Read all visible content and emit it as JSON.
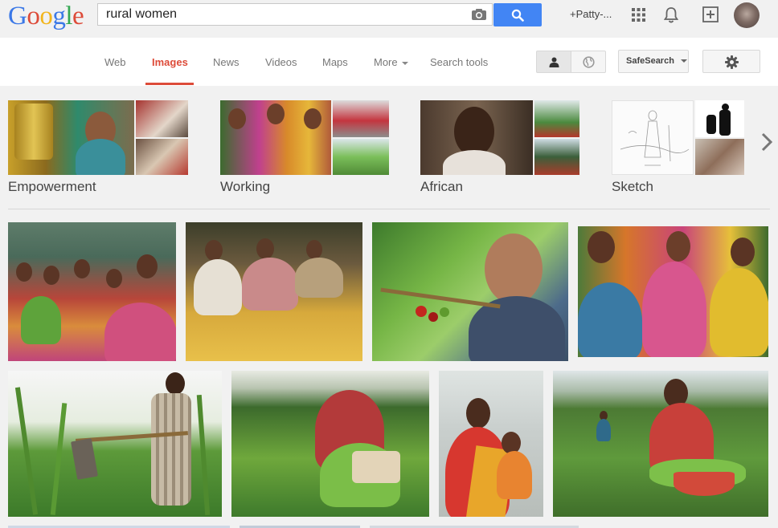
{
  "header": {
    "logo": [
      "G",
      "o",
      "o",
      "g",
      "l",
      "e"
    ],
    "search": {
      "value": "rural women"
    },
    "user": "+Patty-...",
    "icons": [
      "apps-grid-icon",
      "bell-icon",
      "share-plus-icon"
    ]
  },
  "nav": {
    "tabs": [
      {
        "label": "Web"
      },
      {
        "label": "Images"
      },
      {
        "label": "News"
      },
      {
        "label": "Videos"
      },
      {
        "label": "Maps"
      },
      {
        "label": "More"
      },
      {
        "label": "Search tools"
      }
    ],
    "active_tab": "Images",
    "safesearch_label": "SafeSearch",
    "colors": {
      "accent": "#dd4b39",
      "search_button": "#4285f4"
    }
  },
  "related": [
    {
      "label": "Empowerment"
    },
    {
      "label": "Working"
    },
    {
      "label": "African"
    },
    {
      "label": "Sketch"
    }
  ]
}
